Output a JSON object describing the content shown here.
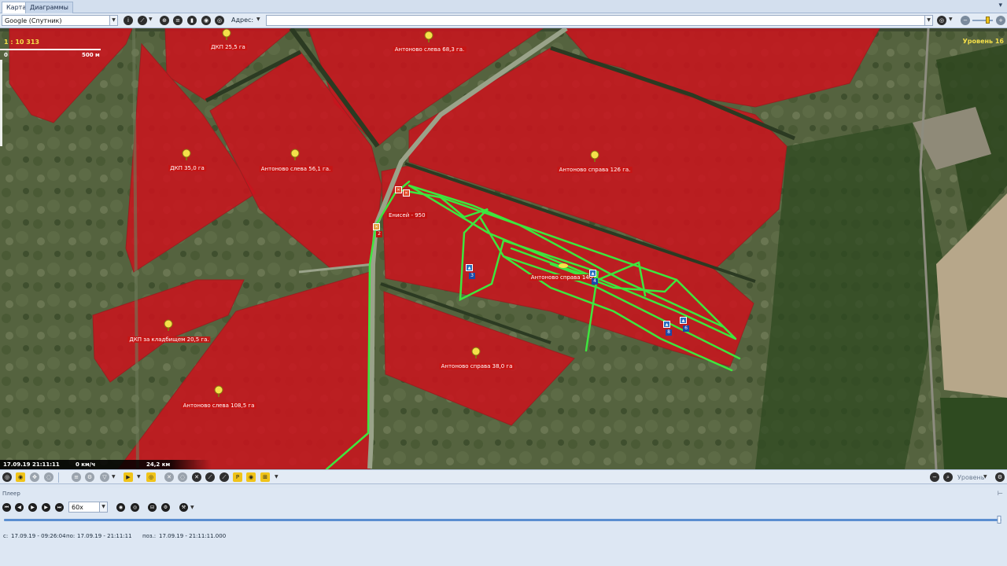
{
  "tabs": [
    "Карта",
    "Диаграммы"
  ],
  "toolbar": {
    "map_source": "Google (Спутник)",
    "address_label": "Адрес:",
    "address_value": ""
  },
  "map": {
    "scale_ratio": "1 : 10 313",
    "scale_start": "0",
    "scale_end": "500 м",
    "zoom_level": "Уровень 16",
    "field_labels": [
      "ДКП 25,5 га",
      "Антоново слева 68,3 га.",
      "ДКП 35,0 га",
      "Антоново слева 56,1 га.",
      "Антоново справа 126 га.",
      "ДКП за кладбищем 20,5 га.",
      "Антоново справа 38,0 га",
      "Антоново слева 108,5 га",
      "Антоново справа 140"
    ],
    "vehicle_label": "Енисей - 950",
    "markers": [
      "2",
      "3",
      "4",
      "6",
      "8"
    ]
  },
  "status": {
    "datetime": "17.09.19 21:11:11",
    "speed": "0 км/ч",
    "distance": "24,2 км"
  },
  "bottom_toolbar": {
    "level_label": "Уровень"
  },
  "player": {
    "title": "Плеер",
    "speed": "60x",
    "progress_fraction": 0.998,
    "from_label": "с:",
    "from_value": "17.09.19 - 09:26:04",
    "to_label": "по:",
    "to_value": "17.09.19 - 21:11:11",
    "pos_label": "поз.:",
    "pos_value": "17.09.19 - 21:11:11.000"
  },
  "colors": {
    "field_fill": "#c8141e",
    "track": "#3ee63e",
    "accent": "#f0c419"
  }
}
